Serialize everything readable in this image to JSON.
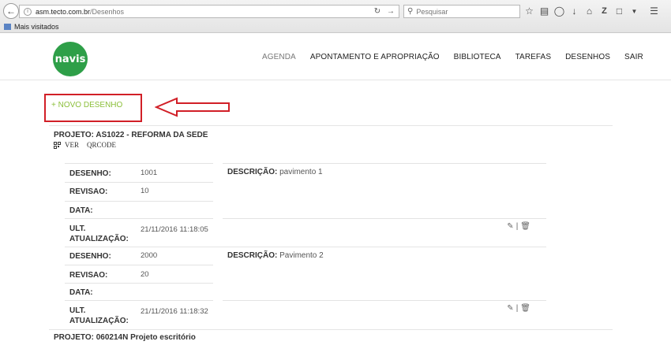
{
  "browser": {
    "url_host": "asm.tecto.com.br",
    "url_path": "/Desenhos",
    "search_placeholder": "Pesquisar",
    "bookmark_label": "Mais visitados"
  },
  "nav": {
    "logo_text": "navis",
    "items": [
      "AGENDA",
      "APONTAMENTO E APROPRIAÇÃO",
      "BIBLIOTECA",
      "TAREFAS",
      "DESENHOS",
      "SAIR"
    ]
  },
  "new_drawing": "+ NOVO DESENHO",
  "project1": {
    "title": "PROJETO: AS1022 - REFORMA DA SEDE",
    "view_label": "VER",
    "qrcode_label": "QRCODE"
  },
  "labels": {
    "desenho": "DESENHO:",
    "revisao": "REVISAO:",
    "data": "DATA:",
    "ult": "ULT.",
    "atualizacao": "ATUALIZAÇÃO:",
    "descricao": "DESCRIÇÃO:"
  },
  "drawings": [
    {
      "desenho": "1001",
      "revisao": "10",
      "data": "",
      "atualizacao": "21/11/2016 11:18:05",
      "descricao": "pavimento 1"
    },
    {
      "desenho": "2000",
      "revisao": "20",
      "data": "",
      "atualizacao": "21/11/2016 11:18:32",
      "descricao": "Pavimento 2"
    }
  ],
  "project2": {
    "title": "PROJETO: 060214N Projeto escritório"
  },
  "colors": {
    "logo": "#2e9f48",
    "new_link": "#8bbf3a",
    "highlight": "#d11f27"
  }
}
